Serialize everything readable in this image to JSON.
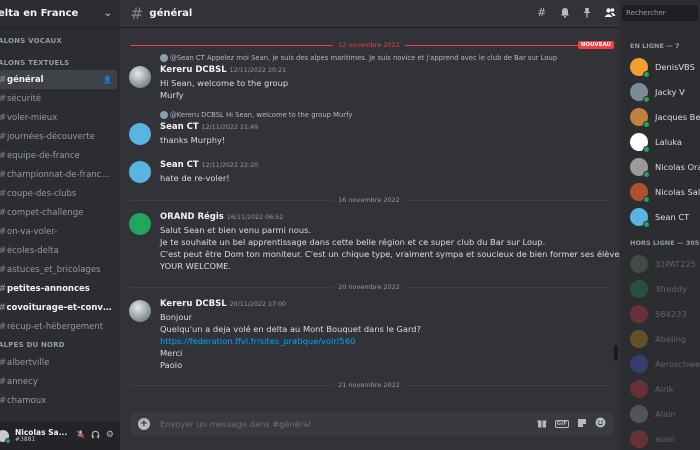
{
  "sidebar": {
    "server_name": "elta en France",
    "categories": {
      "voice": "ALONS VOCAUX",
      "text": "ALONS TEXTUELS",
      "alpes": "ALPES DU NORD"
    },
    "channels": [
      {
        "label": "général",
        "state": "active"
      },
      {
        "label": "sécurité",
        "state": "normal"
      },
      {
        "label": "voler-mieux",
        "state": "normal"
      },
      {
        "label": "journées-découverte",
        "state": "normal"
      },
      {
        "label": "equipe-de-france",
        "state": "normal"
      },
      {
        "label": "championnat-de-franc...",
        "state": "normal"
      },
      {
        "label": "coupe-des-clubs",
        "state": "normal"
      },
      {
        "label": "compet-challenge",
        "state": "normal"
      },
      {
        "label": "on-va-voler-",
        "state": "normal"
      },
      {
        "label": "écoles-delta",
        "state": "normal"
      },
      {
        "label": "astuces_et_bricolages",
        "state": "normal"
      },
      {
        "label": "petites-annonces",
        "state": "unread"
      },
      {
        "label": "covoiturage-et-convoy...",
        "state": "unread"
      },
      {
        "label": "récup-et-hébergement",
        "state": "normal"
      }
    ],
    "alpes_channels": [
      {
        "label": "albertville",
        "state": "normal"
      },
      {
        "label": "annecy",
        "state": "normal"
      },
      {
        "label": "chamoux",
        "state": "normal"
      }
    ],
    "user": {
      "name": "Nicolas Sa...",
      "tag": "#3881"
    }
  },
  "header": {
    "channel": "général",
    "search_placeholder": "Rechercher",
    "icons": [
      "threads-icon",
      "bell-icon",
      "pin-icon",
      "members-icon"
    ]
  },
  "messages": {
    "new_divider": {
      "date": "12 novembre 2022",
      "badge": "NOUVEAU"
    },
    "m1": {
      "reply": "@Sean CT Appelez moi Sean, je suis des alpes maritimes. Je suis novice et j'apprend avec le club de Bar sur Loup",
      "author": "Kereru DCBSL",
      "time": "12/11/2022 20:21",
      "lines": [
        "Hi Sean, welcome to the group",
        "Murfy"
      ]
    },
    "m2": {
      "reply": "@Kereru DCBSL Hi Sean, welcome to the group Murfy",
      "author": "Sean CT",
      "time": "12/11/2022 21:49",
      "lines": [
        "thanks Murphy!"
      ]
    },
    "m3": {
      "author": "Sean CT",
      "time": "12/11/2022 22:20",
      "lines": [
        "hate de re-voler!"
      ]
    },
    "div2": "16 novembre 2022",
    "m4": {
      "author": "ORAND Régis",
      "time": "16/11/2022 06:52",
      "lines": [
        "Salut Sean et bien venu parmi nous.",
        "Je te souhaite un bel apprentissage dans cette belle région et ce super club du Bar sur Loup.",
        "C'est peut être Dom ton moniteur. C'est un chique type, vraiment sympa et soucieux de bien former ses élèves.",
        "YOUR WELCOME."
      ]
    },
    "div3": "20 novembre 2022",
    "m5": {
      "author": "Kereru DCBSL",
      "time": "20/11/2022 17:00",
      "lines": [
        "Bonjour",
        "Quelqu'un a deja volé en delta au Mont Bouquet dans le Gard?"
      ],
      "link": "https://federation.ffvl.fr/sites_pratique/voir/560",
      "lines2": [
        "Merci",
        "Paolo"
      ]
    },
    "div4": "21 novembre 2022"
  },
  "composer": {
    "placeholder": "Envoyer un message dans #général"
  },
  "members": {
    "online_header": "EN LIGNE — 7",
    "online": [
      {
        "name": "DenisVBS",
        "color": "#f0a030"
      },
      {
        "name": "Jacky V",
        "color": "#7a8c9a"
      },
      {
        "name": "Jacques Be",
        "color": "#c08040"
      },
      {
        "name": "Laluka",
        "color": "#ffffff"
      },
      {
        "name": "Nicolas Ora",
        "color": "#9a9a9a"
      },
      {
        "name": "Nicolas Sal",
        "color": "#b05030"
      },
      {
        "name": "Sean CT",
        "color": "#5ab4e0"
      }
    ],
    "offline_header": "HORS LIGNE — 305",
    "offline": [
      {
        "name": "31PAT225",
        "color": "#7a8a70"
      },
      {
        "name": "3freddy",
        "color": "#23a55a"
      },
      {
        "name": "584233",
        "color": "#f23f43"
      },
      {
        "name": "Abeling",
        "color": "#e0a020"
      },
      {
        "name": "Aeroschwe",
        "color": "#5865f2"
      },
      {
        "name": "Airik",
        "color": "#f23f43"
      },
      {
        "name": "Alain",
        "color": "#b0b0b0"
      },
      {
        "name": "alain",
        "color": "#f23f43"
      }
    ]
  }
}
